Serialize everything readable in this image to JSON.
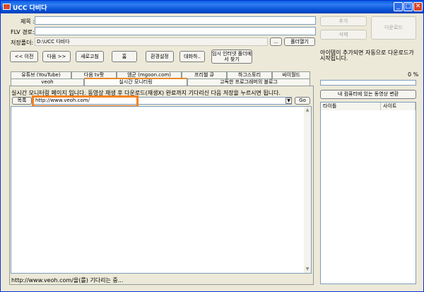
{
  "window": {
    "title": "UCC 다비다"
  },
  "form": {
    "title_label": "제목 :",
    "title_value": "",
    "flv_label": "FLV 경로:",
    "flv_value": "",
    "save_label": "저장폴더:",
    "save_value": "D:\\UCC 다비다",
    "browse_label": "...",
    "open_folder_label": "폴더열기"
  },
  "right": {
    "add_label": "추가",
    "delete_label": "삭제",
    "download_label": "다운로드",
    "info_text": "아이템이 추가되면 자동으로 다운로드가 시작됩니다.",
    "percent": "0 %",
    "progress": 0,
    "convert_label": "내 컴퓨터에 있는 동영상 변환",
    "col_title": "타이틀",
    "col_site": "사이트"
  },
  "toolbar": {
    "prev": "<< 이전",
    "next": "다음 >>",
    "refresh": "새로고침",
    "home": "홈",
    "settings": "환경설정",
    "chat": "대화하..",
    "internet_folder": "임시 인터넷 폴더에서 찾기"
  },
  "tabs": {
    "row1": [
      "유튜브 (YouTube)",
      "다음 tv팟",
      "엠군 (mgoon.com)",
      "프리첼 큐",
      "하그스토리",
      "싸이월드"
    ],
    "row2": [
      "veoh",
      "실시간 모니터링",
      "고독한 프로그래머의 블로그"
    ]
  },
  "monitor": {
    "info": "실시간 모니터링 페이지 입니다. 동영상 재생 후 다운로드(재생X) 완료까지 기다리신 다음 저장을 누르시면 됩니다.",
    "list_label": "목록",
    "url_value": "http://www.veoh.com/",
    "go_label": "Go",
    "status": "http://www.veoh.com/을(를) 기다리는 중..."
  }
}
